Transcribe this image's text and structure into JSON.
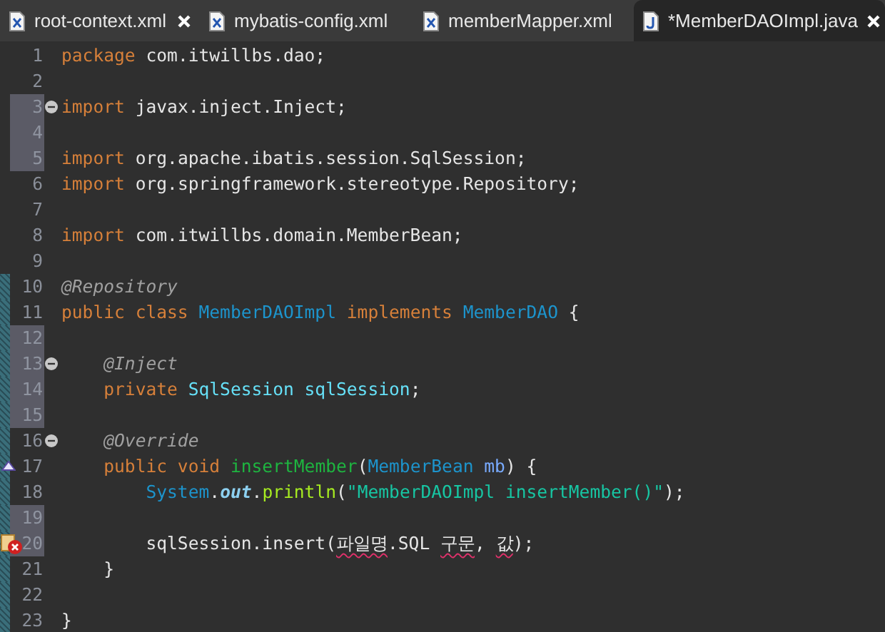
{
  "tabs": [
    {
      "label": "root-context.xml",
      "kind": "xml",
      "selected": false,
      "closable": true
    },
    {
      "label": "mybatis-config.xml",
      "kind": "xml",
      "selected": false,
      "closable": false
    },
    {
      "label": "memberMapper.xml",
      "kind": "xml",
      "selected": false,
      "closable": false
    },
    {
      "label": "*MemberDAOImpl.java",
      "kind": "java",
      "selected": true,
      "closable": true
    }
  ],
  "lines": [
    {
      "number": "1",
      "changed": false,
      "added": false,
      "tokens": [
        {
          "kind": "kw",
          "text": "package"
        },
        {
          "kind": "plain",
          "text": " com.itwillbs.dao;"
        }
      ]
    },
    {
      "number": "2",
      "changed": false,
      "added": false
    },
    {
      "number": "3",
      "changed": true,
      "added": false,
      "gutter_icon": {
        "kind": "fold"
      },
      "tokens": [
        {
          "kind": "kw",
          "text": "import"
        },
        {
          "kind": "plain",
          "text": " javax.inject.Inject;"
        }
      ]
    },
    {
      "number": "4",
      "changed": true,
      "added": false
    },
    {
      "number": "5",
      "changed": true,
      "added": false,
      "tokens": [
        {
          "kind": "kw",
          "text": "import"
        },
        {
          "kind": "plain",
          "text": " org.apache.ibatis.session.SqlSession;"
        }
      ]
    },
    {
      "number": "6",
      "changed": false,
      "added": false,
      "tokens": [
        {
          "kind": "kw",
          "text": "import"
        },
        {
          "kind": "plain",
          "text": " org.springframework.stereotype.Repository;"
        }
      ]
    },
    {
      "number": "7",
      "changed": false,
      "added": false
    },
    {
      "number": "8",
      "changed": false,
      "added": false,
      "tokens": [
        {
          "kind": "kw",
          "text": "import"
        },
        {
          "kind": "plain",
          "text": " com.itwillbs.domain.MemberBean;"
        }
      ]
    },
    {
      "number": "9",
      "changed": false,
      "added": false
    },
    {
      "number": "10",
      "changed": false,
      "added": true,
      "tokens": [
        {
          "kind": "annotation",
          "text": "@Repository"
        }
      ]
    },
    {
      "number": "11",
      "changed": false,
      "added": true,
      "tokens": [
        {
          "kind": "kw",
          "text": "public class "
        },
        {
          "kind": "type",
          "text": "MemberDAOImpl"
        },
        {
          "kind": "kw",
          "text": " implements "
        },
        {
          "kind": "type",
          "text": "MemberDAO"
        },
        {
          "kind": "plain",
          "text": " {"
        }
      ]
    },
    {
      "number": "12",
      "changed": true,
      "added": true
    },
    {
      "number": "13",
      "changed": true,
      "added": true,
      "gutter_icon": {
        "kind": "fold"
      },
      "tokens": [
        {
          "kind": "annotation",
          "text": "    @Inject"
        }
      ]
    },
    {
      "number": "14",
      "changed": true,
      "added": true,
      "tokens": [
        {
          "kind": "kw",
          "text": "    private "
        },
        {
          "kind": "field",
          "text": "SqlSession sqlSession"
        },
        {
          "kind": "plain",
          "text": ";"
        }
      ]
    },
    {
      "number": "15",
      "changed": true,
      "added": true
    },
    {
      "number": "16",
      "changed": false,
      "added": true,
      "gutter_icon": {
        "kind": "fold"
      },
      "tokens": [
        {
          "kind": "annotation",
          "text": "    @Override"
        }
      ]
    },
    {
      "number": "17",
      "changed": false,
      "added": true,
      "gutter_icon": {
        "kind": "override"
      },
      "tokens": [
        {
          "kind": "kw",
          "text": "    public void "
        },
        {
          "kind": "method",
          "text": "insertMember"
        },
        {
          "kind": "plain",
          "text": "("
        },
        {
          "kind": "type",
          "text": "MemberBean "
        },
        {
          "kind": "param",
          "text": "mb"
        },
        {
          "kind": "plain",
          "text": ") {"
        }
      ]
    },
    {
      "number": "18",
      "changed": false,
      "added": true,
      "tokens": [
        {
          "kind": "type",
          "text": "        System"
        },
        {
          "kind": "plain",
          "text": "."
        },
        {
          "kind": "staticfield",
          "text": "out"
        },
        {
          "kind": "plain",
          "text": "."
        },
        {
          "kind": "call",
          "text": "println"
        },
        {
          "kind": "plain",
          "text": "("
        },
        {
          "kind": "string",
          "text": "\"MemberDAOImpl insertMember()\""
        },
        {
          "kind": "plain",
          "text": ");"
        }
      ]
    },
    {
      "number": "19",
      "changed": true,
      "added": true
    },
    {
      "number": "20",
      "changed": true,
      "added": true,
      "gutter_icon": {
        "kind": "error"
      },
      "tokens": [
        {
          "kind": "plain",
          "text": "        sqlSession.insert("
        },
        {
          "kind": "error",
          "text": "파일명"
        },
        {
          "kind": "plain",
          "text": ".SQL "
        },
        {
          "kind": "error",
          "text": "구문"
        },
        {
          "kind": "plain",
          "text": ", "
        },
        {
          "kind": "error",
          "text": "값"
        },
        {
          "kind": "plain",
          "text": ");"
        }
      ]
    },
    {
      "number": "21",
      "changed": false,
      "added": true,
      "tokens": [
        {
          "kind": "plain",
          "text": "    }"
        }
      ]
    },
    {
      "number": "22",
      "changed": false,
      "added": true
    },
    {
      "number": "23",
      "changed": false,
      "added": true,
      "tokens": [
        {
          "kind": "plain",
          "text": "}"
        }
      ]
    }
  ]
}
